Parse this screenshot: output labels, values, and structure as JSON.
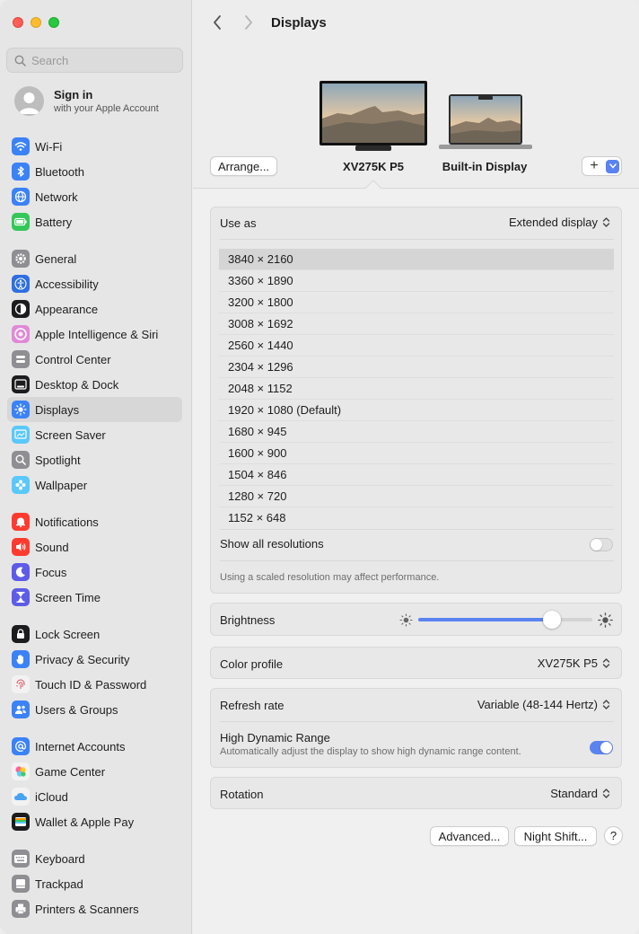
{
  "sidebar": {
    "search_placeholder": "Search",
    "signin": {
      "title": "Sign in",
      "subtitle": "with your Apple Account"
    },
    "groups": [
      [
        {
          "label": "Wi-Fi",
          "icon": "wifi-icon",
          "color": "#3b82f6"
        },
        {
          "label": "Bluetooth",
          "icon": "bluetooth-icon",
          "color": "#3b82f6"
        },
        {
          "label": "Network",
          "icon": "globe-icon",
          "color": "#3b82f6"
        },
        {
          "label": "Battery",
          "icon": "battery-icon",
          "color": "#34c759"
        }
      ],
      [
        {
          "label": "General",
          "icon": "gear-icon",
          "color": "#8e8e93"
        },
        {
          "label": "Accessibility",
          "icon": "accessibility-icon",
          "color": "#2f6fe0"
        },
        {
          "label": "Appearance",
          "icon": "appearance-icon",
          "color": "#1c1c1e"
        },
        {
          "label": "Apple Intelligence & Siri",
          "icon": "siri-icon",
          "color": "#e08ad6"
        },
        {
          "label": "Control Center",
          "icon": "control-center-icon",
          "color": "#8e8e93"
        },
        {
          "label": "Desktop & Dock",
          "icon": "dock-icon",
          "color": "#1c1c1e"
        },
        {
          "label": "Displays",
          "icon": "sun-icon",
          "color": "#3b82f6"
        },
        {
          "label": "Screen Saver",
          "icon": "screen-saver-icon",
          "color": "#5ac8fa"
        },
        {
          "label": "Spotlight",
          "icon": "magnifier-icon",
          "color": "#8e8e93"
        },
        {
          "label": "Wallpaper",
          "icon": "flower-icon",
          "color": "#5ac8fa"
        }
      ],
      [
        {
          "label": "Notifications",
          "icon": "bell-icon",
          "color": "#ff3b30"
        },
        {
          "label": "Sound",
          "icon": "speaker-icon",
          "color": "#ff3b30"
        },
        {
          "label": "Focus",
          "icon": "moon-icon",
          "color": "#5e5ce6"
        },
        {
          "label": "Screen Time",
          "icon": "hourglass-icon",
          "color": "#5e5ce6"
        }
      ],
      [
        {
          "label": "Lock Screen",
          "icon": "lock-icon",
          "color": "#1c1c1e"
        },
        {
          "label": "Privacy & Security",
          "icon": "hand-icon",
          "color": "#3b82f6"
        },
        {
          "label": "Touch ID & Password",
          "icon": "fingerprint-icon",
          "color": "#f2f2f2"
        },
        {
          "label": "Users & Groups",
          "icon": "users-icon",
          "color": "#3b82f6"
        }
      ],
      [
        {
          "label": "Internet Accounts",
          "icon": "at-icon",
          "color": "#3b82f6"
        },
        {
          "label": "Game Center",
          "icon": "game-center-icon",
          "color": "#f2f2f2"
        },
        {
          "label": "iCloud",
          "icon": "cloud-icon",
          "color": "#f2f2f2"
        },
        {
          "label": "Wallet & Apple Pay",
          "icon": "wallet-icon",
          "color": "#1c1c1e"
        }
      ],
      [
        {
          "label": "Keyboard",
          "icon": "keyboard-icon",
          "color": "#8e8e93"
        },
        {
          "label": "Trackpad",
          "icon": "trackpad-icon",
          "color": "#8e8e93"
        },
        {
          "label": "Printers & Scanners",
          "icon": "printer-icon",
          "color": "#8e8e93"
        }
      ]
    ],
    "selected": "Displays"
  },
  "header": {
    "title": "Displays"
  },
  "displays": {
    "arrange_label": "Arrange...",
    "add_label": "+",
    "items": [
      {
        "name": "XV275K P5",
        "selected": true
      },
      {
        "name": "Built-in Display",
        "selected": false
      }
    ]
  },
  "settings": {
    "use_as": {
      "label": "Use as",
      "value": "Extended display"
    },
    "resolutions": [
      "3840 × 2160",
      "3360 × 1890",
      "3200 × 1800",
      "3008 × 1692",
      "2560 × 1440",
      "2304 × 1296",
      "2048 × 1152",
      "1920 × 1080 (Default)",
      "1680 × 945",
      "1600 × 900",
      "1504 × 846",
      "1280 × 720",
      "1152 × 648"
    ],
    "selected_resolution": "3840 × 2160",
    "show_all": {
      "label": "Show all resolutions",
      "on": false
    },
    "scaled_hint": "Using a scaled resolution may affect performance.",
    "brightness": {
      "label": "Brightness",
      "level": 0.77
    },
    "color_profile": {
      "label": "Color profile",
      "value": "XV275K P5"
    },
    "refresh_rate": {
      "label": "Refresh rate",
      "value": "Variable (48-144 Hertz)"
    },
    "hdr": {
      "label": "High Dynamic Range",
      "description": "Automatically adjust the display to show high dynamic range content.",
      "on": true
    },
    "rotation": {
      "label": "Rotation",
      "value": "Standard"
    }
  },
  "footer": {
    "advanced_label": "Advanced...",
    "night_shift_label": "Night Shift...",
    "help_label": "?"
  },
  "colors": {
    "accent": "#5a83f0",
    "selected_row": "#d5d5d5"
  }
}
